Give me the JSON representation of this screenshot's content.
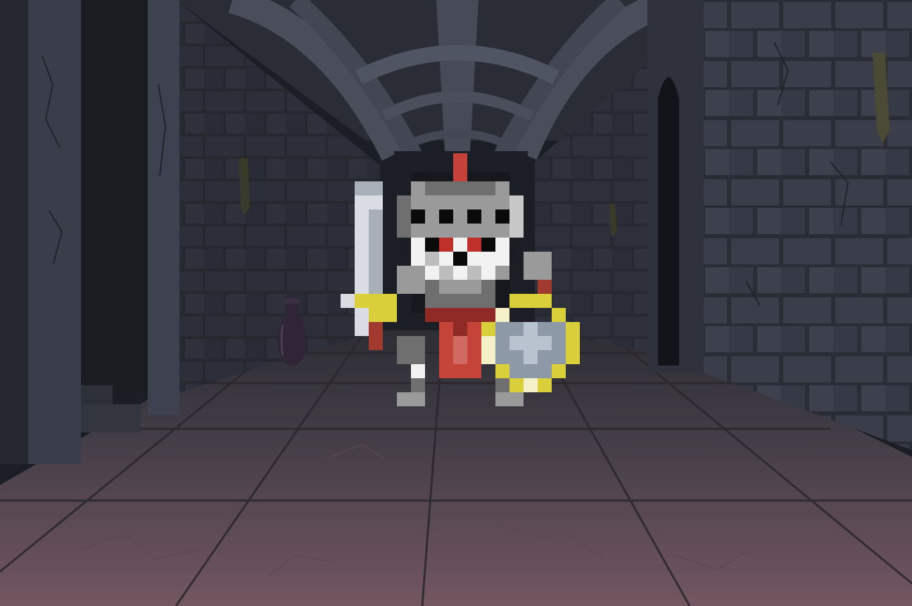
{
  "scene": {
    "name": "dungeon-corridor",
    "palette": {
      "stone_dark": "#22252d",
      "stone_mid": "#3b3f4b",
      "stone_light": "#4f5462",
      "mortar": "#1a1c22",
      "floor_far": "#3c3a42",
      "floor_near": "#6e5560",
      "vault": "#474b57",
      "vase": "#2f2536"
    }
  },
  "enemy": {
    "type": "armored-knight-skeleton",
    "sprite_palette": {
      "plume": "#c5423b",
      "helmet_dark": "#6f6f6f",
      "helmet": "#9a9a9a",
      "helmet_light": "#c7c7c7",
      "visor_slot": "#0a0a0a",
      "eye": "#c0302a",
      "skull": "#f2f2f2",
      "skull_shade": "#bdbdbd",
      "tabard": "#c4443a",
      "tabard_shade": "#8f2a26",
      "blade": "#d9dde3",
      "blade_shade": "#a9afb8",
      "hilt_gold": "#d8cf3a",
      "grip": "#a33a2f",
      "shield_rim": "#d8cf3a",
      "shield_rim_light": "#f4f0c8",
      "shield_face": "#8e99a8",
      "shield_cross": "#b9c3cf"
    }
  }
}
